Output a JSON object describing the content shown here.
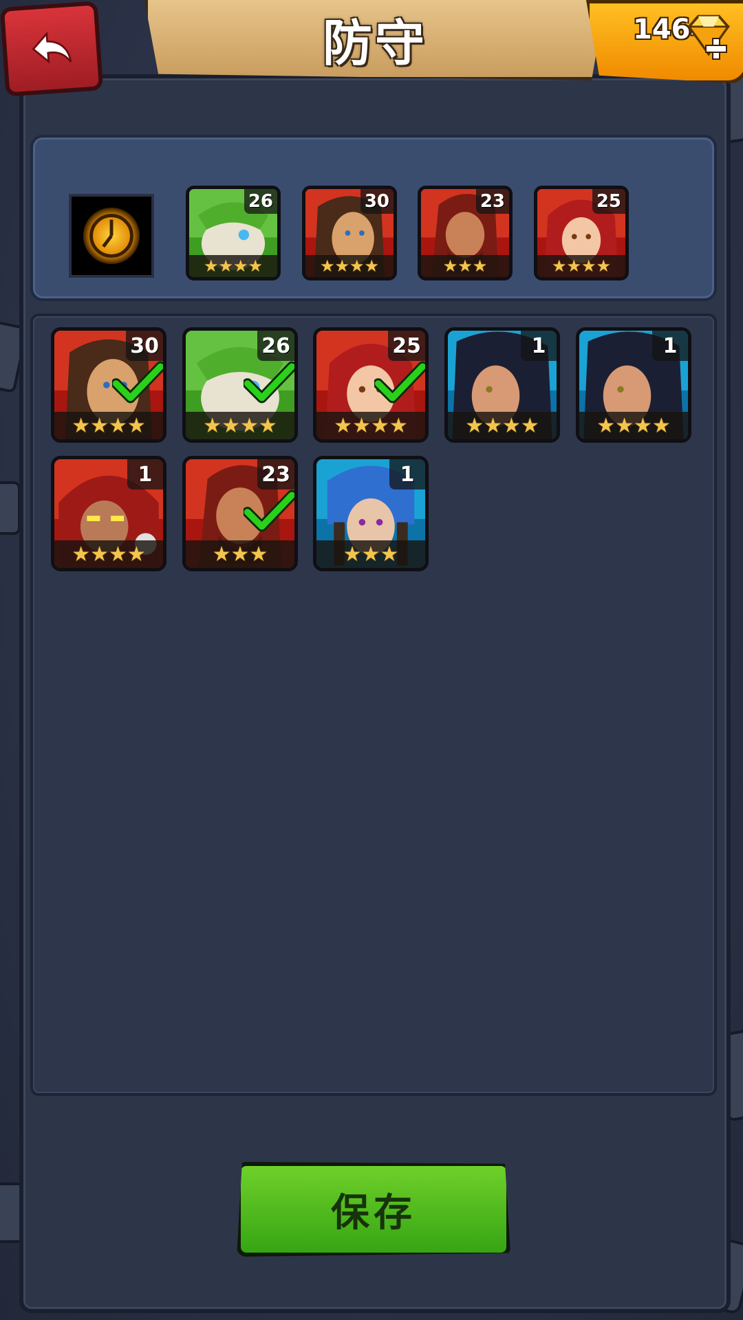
{
  "header": {
    "title": "防守",
    "gem_count": "1464",
    "back_icon": "back-arrow-icon",
    "gem_icon": "gem-icon"
  },
  "defense_lineup": {
    "emblem_icon": "clock-emblem-icon",
    "slots": [
      {
        "hero": "green-armored-beast",
        "level": "26",
        "stars": "★★★★",
        "theme": "green"
      },
      {
        "hero": "long-haired-warrior",
        "level": "30",
        "stars": "★★★★",
        "theme": "red"
      },
      {
        "hero": "red-haired-brute",
        "level": "23",
        "stars": "★★★",
        "theme": "red"
      },
      {
        "hero": "red-haired-woman",
        "level": "25",
        "stars": "★★★★",
        "theme": "red"
      }
    ]
  },
  "roster": [
    {
      "hero": "long-haired-warrior",
      "level": "30",
      "stars": "★★★★",
      "theme": "red",
      "selected": true
    },
    {
      "hero": "green-armored-beast",
      "level": "26",
      "stars": "★★★★",
      "theme": "green",
      "selected": true
    },
    {
      "hero": "red-haired-woman",
      "level": "25",
      "stars": "★★★★",
      "theme": "red",
      "selected": true
    },
    {
      "hero": "dark-haired-woman",
      "level": "1",
      "stars": "★★★★",
      "theme": "blue",
      "selected": false
    },
    {
      "hero": "dark-haired-woman",
      "level": "1",
      "stars": "★★★★",
      "theme": "blue",
      "selected": false
    },
    {
      "hero": "hooded-gunner",
      "level": "1",
      "stars": "★★★★",
      "theme": "red",
      "selected": false
    },
    {
      "hero": "red-haired-brute",
      "level": "23",
      "stars": "★★★",
      "theme": "red",
      "selected": true
    },
    {
      "hero": "braided-elf-woman",
      "level": "1",
      "stars": "★★★",
      "theme": "blue",
      "selected": false
    }
  ],
  "footer": {
    "save_label": "保存"
  },
  "colors": {
    "red_theme": "#c8221e",
    "green_theme": "#46b11a",
    "blue_theme": "#18a6d8",
    "check": "#2ad11a",
    "star": "#f3c54e"
  }
}
